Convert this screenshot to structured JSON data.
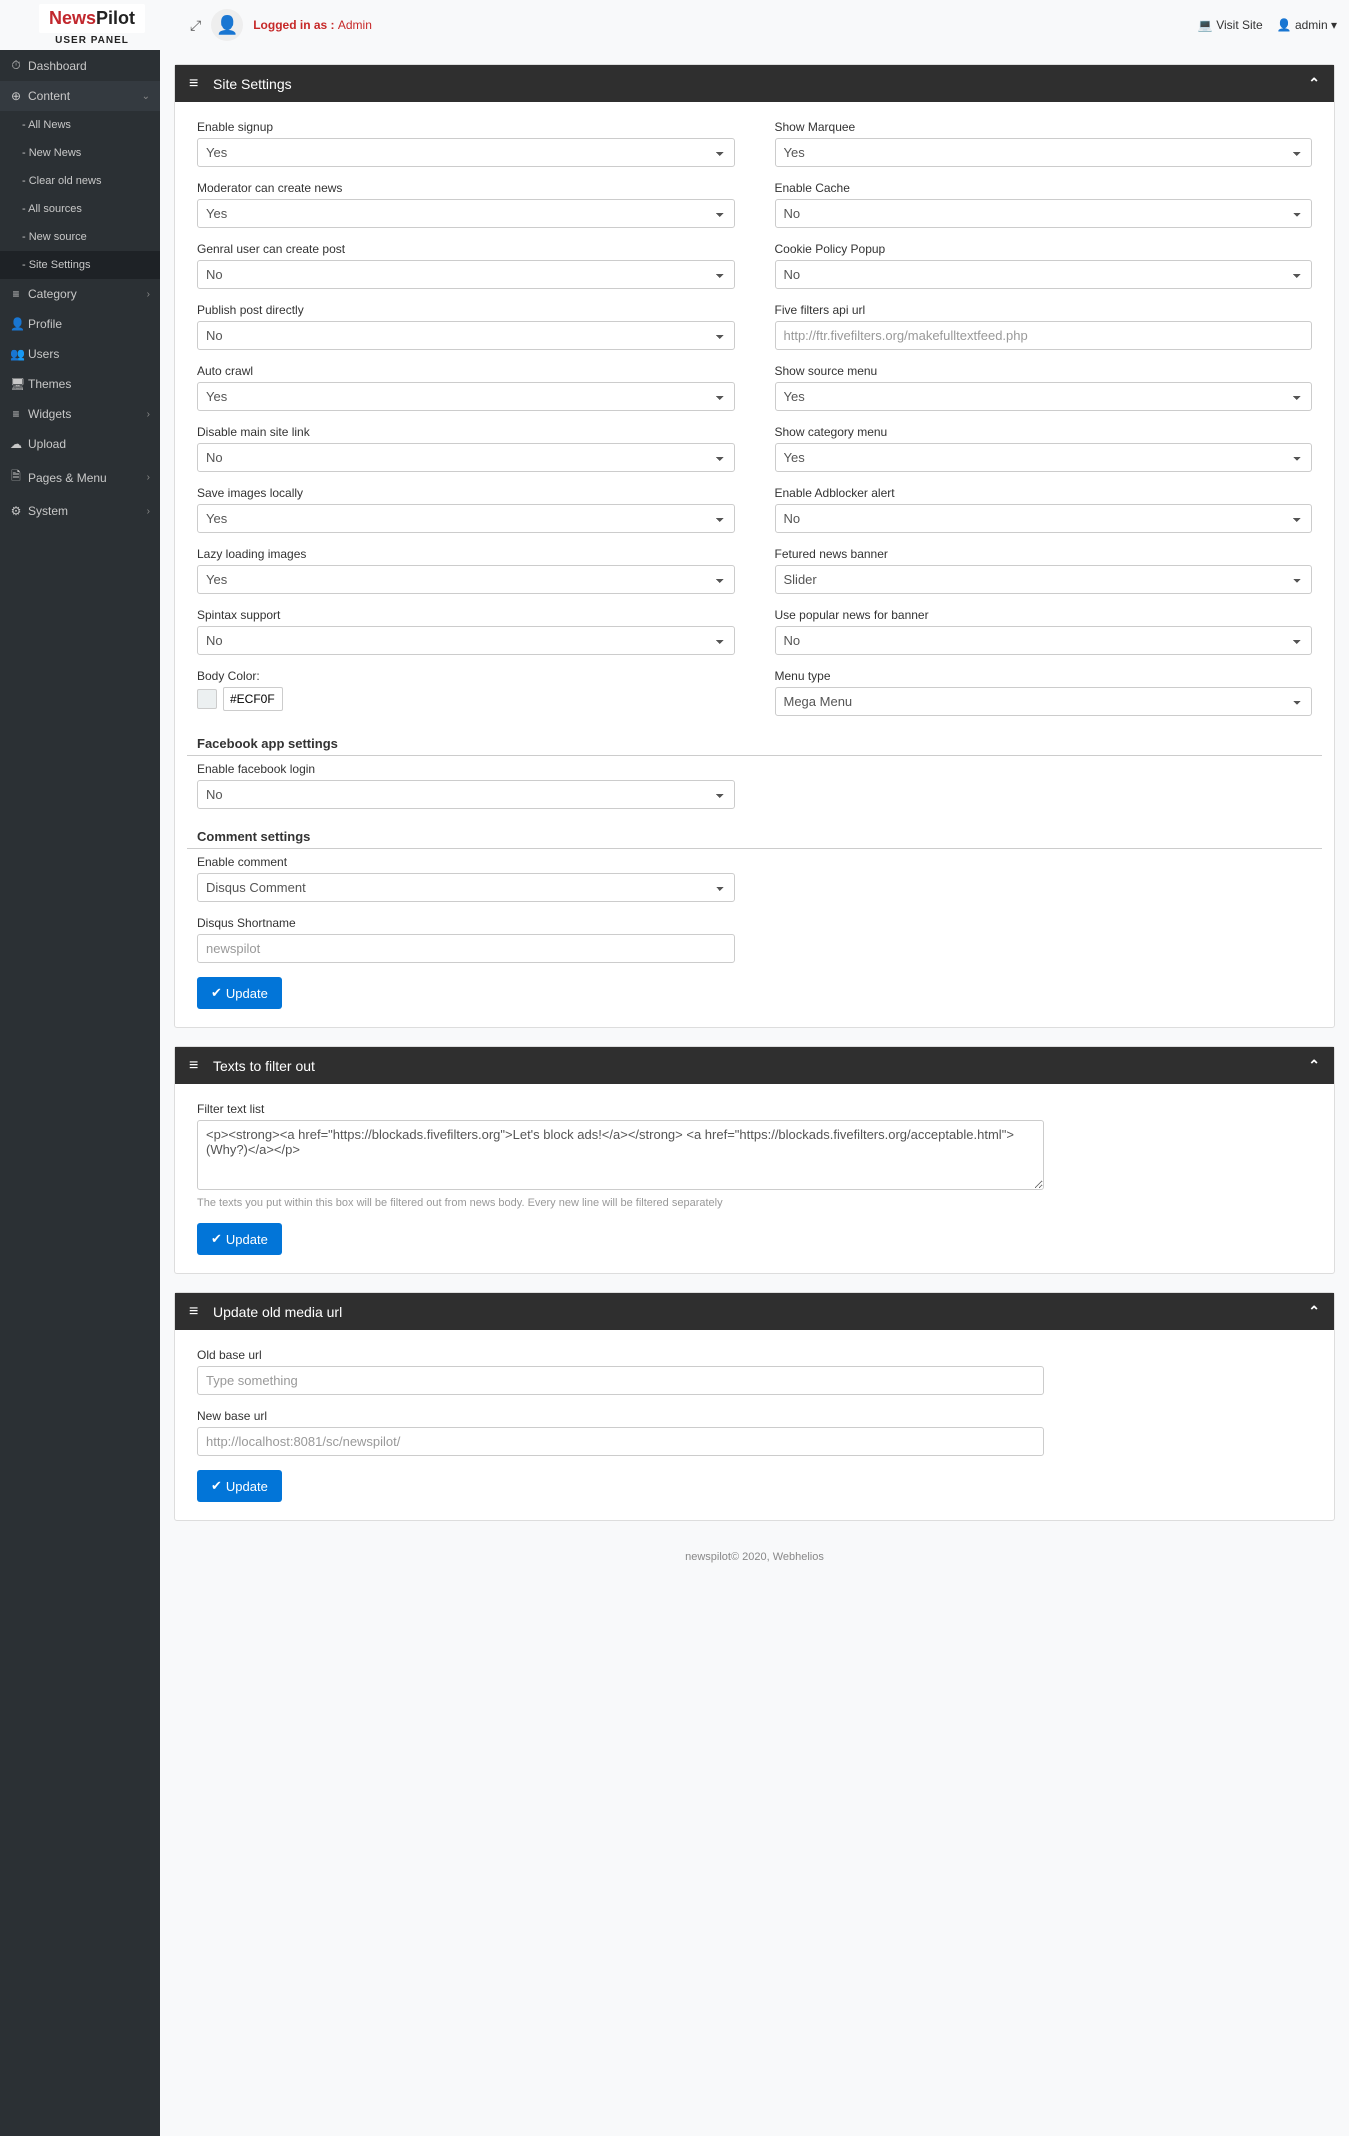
{
  "brand": {
    "news": "News",
    "pilot": "Pilot",
    "sub": "USER PANEL"
  },
  "top": {
    "logged_in_label": "Logged in as : ",
    "logged_in_user": "Admin",
    "visit_site": "Visit Site",
    "admin": "admin"
  },
  "nav": {
    "dashboard": "Dashboard",
    "content": "Content",
    "content_items": {
      "all_news": "- All News",
      "new_news": "- New News",
      "clear_old": "- Clear old news",
      "all_sources": "- All sources",
      "new_source": "- New source",
      "site_settings": "- Site Settings"
    },
    "category": "Category",
    "profile": "Profile",
    "users": "Users",
    "themes": "Themes",
    "widgets": "Widgets",
    "upload": "Upload",
    "pages_menu": "Pages & Menu",
    "system": "System"
  },
  "panel_settings_title": "Site Settings",
  "settings": {
    "left": {
      "enable_signup": {
        "label": "Enable signup",
        "value": "Yes"
      },
      "moderator_create": {
        "label": "Moderator can create news",
        "value": "Yes"
      },
      "genral_user": {
        "label": "Genral user can create post",
        "value": "No"
      },
      "publish_direct": {
        "label": "Publish post directly",
        "value": "No"
      },
      "auto_crawl": {
        "label": "Auto crawl",
        "value": "Yes"
      },
      "disable_main": {
        "label": "Disable main site link",
        "value": "No"
      },
      "save_images": {
        "label": "Save images locally",
        "value": "Yes"
      },
      "lazy_loading": {
        "label": "Lazy loading images",
        "value": "Yes"
      },
      "spintax": {
        "label": "Spintax support",
        "value": "No"
      },
      "body_color": {
        "label": "Body Color:",
        "value": "#ECF0F"
      }
    },
    "right": {
      "show_marquee": {
        "label": "Show Marquee",
        "value": "Yes"
      },
      "enable_cache": {
        "label": "Enable Cache",
        "value": "No"
      },
      "cookie_popup": {
        "label": "Cookie Policy Popup",
        "value": "No"
      },
      "five_filters": {
        "label": "Five filters api url",
        "placeholder": "http://ftr.fivefilters.org/makefulltextfeed.php"
      },
      "show_source": {
        "label": "Show source menu",
        "value": "Yes"
      },
      "show_category": {
        "label": "Show category menu",
        "value": "Yes"
      },
      "adblocker": {
        "label": "Enable Adblocker alert",
        "value": "No"
      },
      "fetured_banner": {
        "label": "Fetured news banner",
        "value": "Slider"
      },
      "popular_banner": {
        "label": "Use popular news for banner",
        "value": "No"
      },
      "menu_type": {
        "label": "Menu type",
        "value": "Mega Menu"
      }
    }
  },
  "facebook": {
    "section": "Facebook app settings",
    "enable_login": {
      "label": "Enable facebook login",
      "value": "No"
    }
  },
  "comments": {
    "section": "Comment settings",
    "enable": {
      "label": "Enable comment",
      "value": "Disqus Comment"
    },
    "disqus_short": {
      "label": "Disqus Shortname",
      "placeholder": "newspilot"
    }
  },
  "update_btn": "Update",
  "filter_panel": {
    "title": "Texts to filter out",
    "label": "Filter text list",
    "value": "<p><strong><a href=\"https://blockads.fivefilters.org\">Let's block ads!</a></strong> <a href=\"https://blockads.fivefilters.org/acceptable.html\">(Why?)</a></p>",
    "help": "The texts you put within this box will be filtered out from news body. Every new line will be filtered separately"
  },
  "media_panel": {
    "title": "Update old media url",
    "old": {
      "label": "Old base url",
      "placeholder": "Type something"
    },
    "new": {
      "label": "New base url",
      "placeholder": "http://localhost:8081/sc/newspilot/"
    }
  },
  "footer": "newspilot© 2020, Webhelios"
}
